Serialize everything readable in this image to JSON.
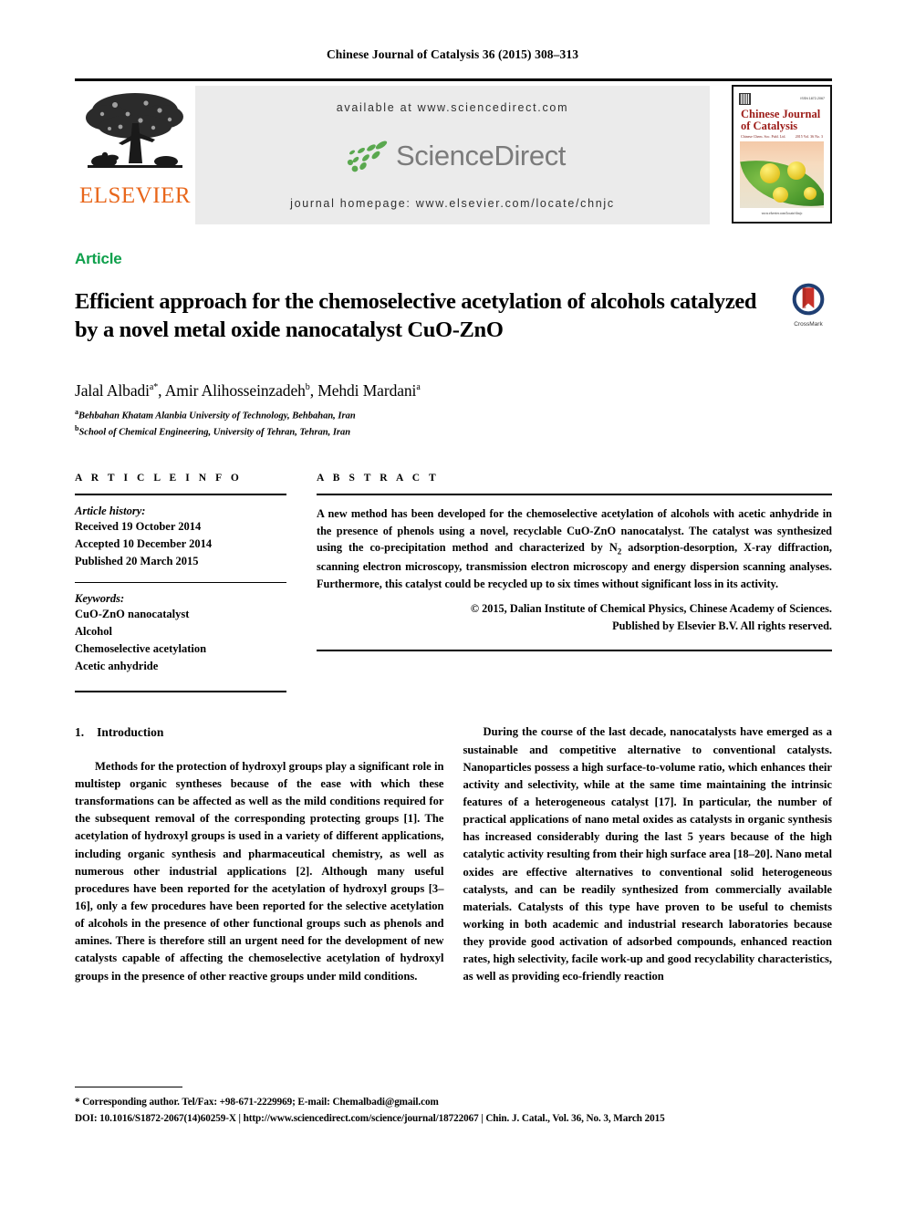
{
  "running_head": "Chinese Journal of Catalysis 36 (2015) 308–313",
  "masthead": {
    "publisher_name": "ELSEVIER",
    "available_at": "available at www.sciencedirect.com",
    "sciencedirect_word": "ScienceDirect",
    "journal_homepage": "journal homepage: www.elsevier.com/locate/chnjc",
    "cover": {
      "title_line1": "Chinese Journal",
      "title_line2": "of Catalysis",
      "issn": "ISSN 1872-2067",
      "subtitle_left": "Chinese Chem. Soc. Publ. Ltd.",
      "subtitle_right": "2015\nVol. 36  No. 3",
      "footer": "www.elsevier.com/locate/chnjc"
    }
  },
  "article_type": "Article",
  "title": "Efficient approach for the chemoselective acetylation of alcohols catalyzed by a novel metal oxide nanocatalyst CuO-ZnO",
  "crossmark_label": "CrossMark",
  "authors": "Jalal Albadi a*, Amir Alihosseinzadeh b, Mehdi Mardani a",
  "authors_parts": [
    {
      "name": "Jalal Albadi",
      "sup": "a*"
    },
    {
      "name": "Amir Alihosseinzadeh",
      "sup": "b"
    },
    {
      "name": "Mehdi Mardani",
      "sup": "a"
    }
  ],
  "affiliations": [
    {
      "sup": "a",
      "text": "Behbahan Khatam Alanbia University of Technology, Behbahan, Iran"
    },
    {
      "sup": "b",
      "text": "School of Chemical Engineering, University of Tehran, Tehran, Iran"
    }
  ],
  "article_info": {
    "heading": "A R T I C L E    I N F O",
    "history_label": "Article history:",
    "history": [
      "Received 19 October 2014",
      "Accepted 10 December 2014",
      "Published 20 March 2015"
    ],
    "keywords_label": "Keywords:",
    "keywords": [
      "CuO-ZnO nanocatalyst",
      "Alcohol",
      "Chemoselective acetylation",
      "Acetic anhydride"
    ]
  },
  "abstract": {
    "heading": "A B S T R A C T",
    "text_before_sub": "A new method has been developed for the chemoselective acetylation of alcohols with acetic anhydride in the presence of phenols using a novel, recyclable CuO-ZnO nanocatalyst. The catalyst was synthesized using the co-precipitation method and characterized by N",
    "sub": "2",
    "text_after_sub": " adsorption-desorption, X-ray diffraction, scanning electron microscopy, transmission electron microscopy and energy dispersion scanning analyses. Furthermore, this catalyst could be recycled up to six times without significant loss in its activity.",
    "copyright_line1": "© 2015, Dalian Institute of Chemical Physics, Chinese Academy of Sciences.",
    "copyright_line2": "Published by Elsevier B.V. All rights reserved."
  },
  "body": {
    "section_number": "1.",
    "section_title": "Introduction",
    "left_paragraph": "Methods for the protection of hydroxyl groups play a significant role in multistep organic syntheses because of the ease with which these transformations can be affected as well as the mild conditions required for the subsequent removal of the corresponding protecting groups [1]. The acetylation of hydroxyl groups is used in a variety of different applications, including organic synthesis and pharmaceutical chemistry, as well as numerous other industrial applications [2]. Although many useful procedures have been reported for the acetylation of hydroxyl groups [3–16], only a few procedures have been reported for the selective acetylation of alcohols in the presence of other functional groups such as phenols and amines. There is therefore still an urgent need for the development of new catalysts capable of affecting the chemoselective acetylation of hydroxyl groups in the presence of other reactive groups under mild conditions.",
    "right_paragraph": "During the course of the last decade, nanocatalysts have emerged as a sustainable and competitive alternative to conventional catalysts. Nanoparticles possess a high surface-to-volume ratio, which enhances their activity and selectivity, while at the same time maintaining the intrinsic features of a heterogeneous catalyst [17]. In particular, the number of practical applications of nano metal oxides as catalysts in organic synthesis has increased considerably during the last 5 years because of the high catalytic activity resulting from their high surface area [18–20]. Nano metal oxides are effective alternatives to conventional solid heterogeneous catalysts, and can be readily synthesized from commercially available materials. Catalysts of this type have proven to be useful to chemists working in both academic and industrial research laboratories because they provide good activation of adsorbed compounds, enhanced reaction rates, high selectivity, facile work-up and good recyclability characteristics, as well as providing eco-friendly reaction"
  },
  "footer": {
    "corresponding": "* Corresponding author. Tel/Fax: +98-671-2229969; E-mail: Chemalbadi@gmail.com",
    "doi_line": "DOI: 10.1016/S1872-2067(14)60259-X | http://www.sciencedirect.com/science/journal/18722067 | Chin. J. Catal., Vol. 36, No. 3, March 2015"
  },
  "colors": {
    "article_green": "#0FA04C",
    "elsevier_orange": "#E8661A",
    "sciencedirect_gray": "#7b7b7b",
    "sciencedirect_green": "#5aa84f",
    "banner_bg": "#ebebeb",
    "cover_red": "#9c1b17",
    "crossmark_blue": "#1f3f73",
    "crossmark_red": "#c8322a"
  }
}
